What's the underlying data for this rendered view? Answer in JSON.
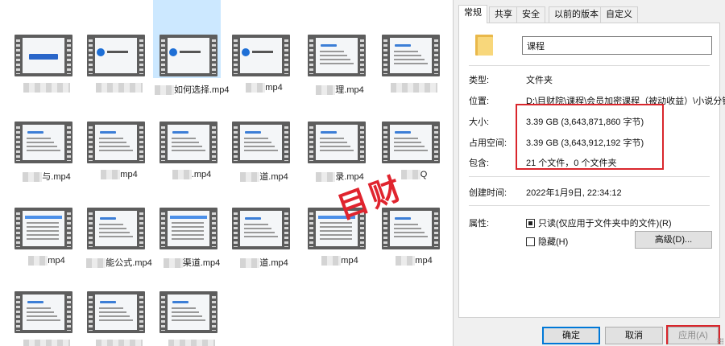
{
  "explorer": {
    "files": [
      {
        "name": "",
        "thumb": "title-dark"
      },
      {
        "name": "",
        "thumb": "logo"
      },
      {
        "name": "如何选择.mp4",
        "thumb": "logo",
        "selected": true
      },
      {
        "name": "mp4",
        "thumb": "logo"
      },
      {
        "name": "理.mp4",
        "thumb": "text"
      },
      {
        "name": "",
        "thumb": "text"
      },
      {
        "name": "与.mp4",
        "thumb": "text"
      },
      {
        "name": "mp4",
        "thumb": "text"
      },
      {
        "name": ".mp4",
        "thumb": "text"
      },
      {
        "name": "道.mp4",
        "thumb": "text"
      },
      {
        "name": "录.mp4",
        "thumb": "text"
      },
      {
        "name": "Q",
        "thumb": "text"
      },
      {
        "name": "mp4",
        "thumb": "table"
      },
      {
        "name": "能公式.mp4",
        "thumb": "text"
      },
      {
        "name": "渠道.mp4",
        "thumb": "table"
      },
      {
        "name": "道.mp4",
        "thumb": "text"
      },
      {
        "name": "mp4",
        "thumb": "table"
      },
      {
        "name": "mp4",
        "thumb": "text"
      },
      {
        "name": "",
        "thumb": "text"
      },
      {
        "name": "",
        "thumb": "text"
      },
      {
        "name": "",
        "thumb": "text"
      }
    ],
    "watermark": "目财"
  },
  "dialog": {
    "tabs": [
      {
        "label": "常规",
        "active": true
      },
      {
        "label": "共享"
      },
      {
        "label": "安全"
      },
      {
        "label": "以前的版本"
      },
      {
        "label": "自定义"
      }
    ],
    "folder_name": "课程",
    "type_label": "类型:",
    "type_value": "文件夹",
    "location_label": "位置:",
    "location_value": "D:\\目财院\\课程\\会员加密课程（被动收益）\\小说分销",
    "size_label": "大小:",
    "size_value": "3.39 GB (3,643,871,860 字节)",
    "disk_label": "占用空间:",
    "disk_value": "3.39 GB (3,643,912,192 字节)",
    "contains_label": "包含:",
    "contains_value": "21 个文件，0 个文件夹",
    "created_label": "创建时间:",
    "created_value": "2022年1月9日, 22:34:12",
    "attributes_label": "属性:",
    "readonly_label": "只读(仅应用于文件夹中的文件)(R)",
    "hidden_label": "隐藏(H)",
    "advanced_button": "高级(D)...",
    "ok_button": "确定",
    "cancel_button": "取消",
    "apply_button": "应用(A)"
  }
}
